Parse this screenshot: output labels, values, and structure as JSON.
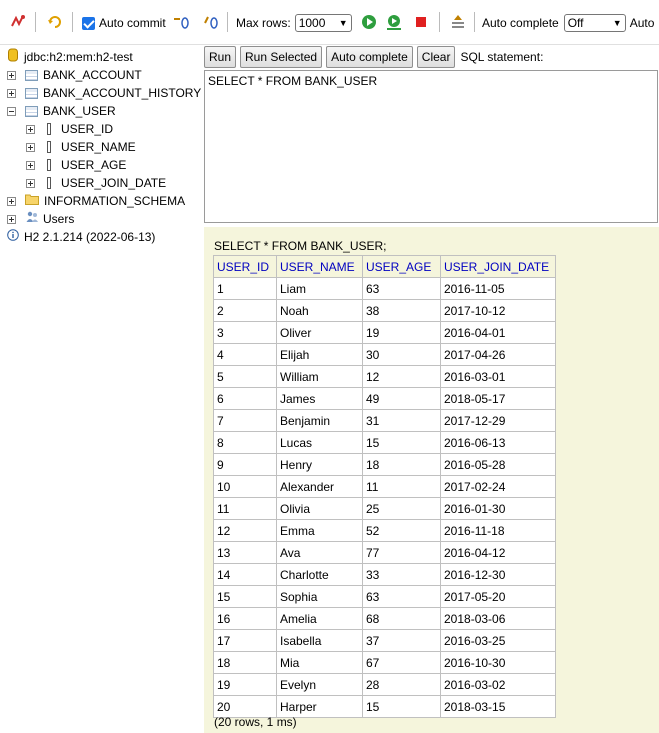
{
  "toolbar": {
    "auto_commit_label": "Auto commit",
    "max_rows_label": "Max rows:",
    "max_rows_value": "1000",
    "auto_complete_label": "Auto complete",
    "auto_complete_value": "Off",
    "auto_select_label": "Auto"
  },
  "tree": {
    "connection": "jdbc:h2:mem:h2-test",
    "tables": [
      "BANK_ACCOUNT",
      "BANK_ACCOUNT_HISTORY",
      "BANK_USER"
    ],
    "columns": [
      "USER_ID",
      "USER_NAME",
      "USER_AGE",
      "USER_JOIN_DATE"
    ],
    "schema": "INFORMATION_SCHEMA",
    "users": "Users",
    "version": "H2 2.1.214 (2022-06-13)"
  },
  "buttons": {
    "run": "Run",
    "run_selected": "Run Selected",
    "auto_complete": "Auto complete",
    "clear": "Clear",
    "sql_label": "SQL statement:"
  },
  "editor": {
    "sql": "SELECT * FROM BANK_USER"
  },
  "result": {
    "query": "SELECT * FROM BANK_USER;",
    "columns": [
      "USER_ID",
      "USER_NAME",
      "USER_AGE",
      "USER_JOIN_DATE"
    ],
    "rows": [
      [
        "1",
        "Liam",
        "63",
        "2016-11-05"
      ],
      [
        "2",
        "Noah",
        "38",
        "2017-10-12"
      ],
      [
        "3",
        "Oliver",
        "19",
        "2016-04-01"
      ],
      [
        "4",
        "Elijah",
        "30",
        "2017-04-26"
      ],
      [
        "5",
        "William",
        "12",
        "2016-03-01"
      ],
      [
        "6",
        "James",
        "49",
        "2018-05-17"
      ],
      [
        "7",
        "Benjamin",
        "31",
        "2017-12-29"
      ],
      [
        "8",
        "Lucas",
        "15",
        "2016-06-13"
      ],
      [
        "9",
        "Henry",
        "18",
        "2016-05-28"
      ],
      [
        "10",
        "Alexander",
        "11",
        "2017-02-24"
      ],
      [
        "11",
        "Olivia",
        "25",
        "2016-01-30"
      ],
      [
        "12",
        "Emma",
        "52",
        "2016-11-18"
      ],
      [
        "13",
        "Ava",
        "77",
        "2016-04-12"
      ],
      [
        "14",
        "Charlotte",
        "33",
        "2016-12-30"
      ],
      [
        "15",
        "Sophia",
        "63",
        "2017-05-20"
      ],
      [
        "16",
        "Amelia",
        "68",
        "2018-03-06"
      ],
      [
        "17",
        "Isabella",
        "37",
        "2016-03-25"
      ],
      [
        "18",
        "Mia",
        "67",
        "2016-10-30"
      ],
      [
        "19",
        "Evelyn",
        "28",
        "2016-03-02"
      ],
      [
        "20",
        "Harper",
        "15",
        "2018-03-15"
      ]
    ],
    "summary": "(20 rows, 1 ms)"
  }
}
